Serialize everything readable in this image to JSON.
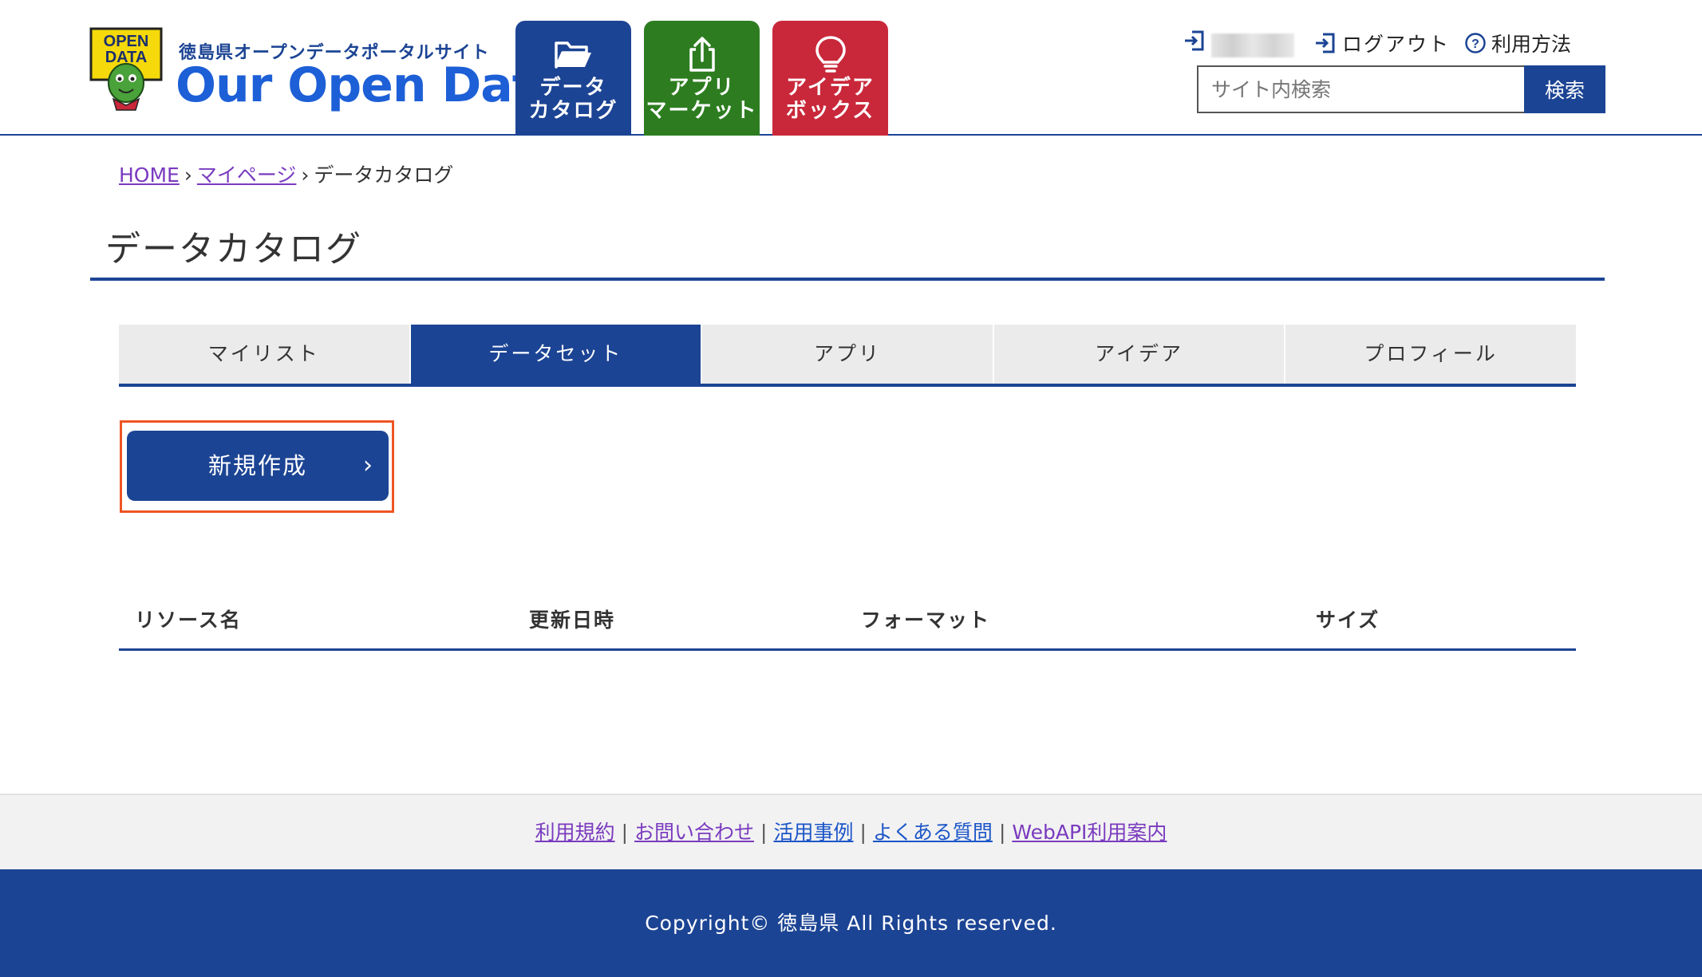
{
  "header": {
    "logo_badge_line1": "OPEN",
    "logo_badge_line2": "DATA",
    "site_subtitle": "徳島県オープンデータポータルサイト",
    "site_title": "Our Open Data",
    "nav": [
      {
        "label": "データ\nカタログ",
        "icon": "folder-open-icon",
        "color": "#1c4494"
      },
      {
        "label": "アプリ\nマーケット",
        "icon": "share-upload-icon",
        "color": "#2d7d20"
      },
      {
        "label": "アイデア\nボックス",
        "icon": "lightbulb-icon",
        "color": "#c9283a"
      }
    ],
    "logout_label": "ログアウト",
    "help_label": "利用方法",
    "search_placeholder": "サイト内検索",
    "search_button": "検索"
  },
  "breadcrumb": {
    "home": "HOME",
    "sep": "›",
    "mypage": "マイページ",
    "current": "データカタログ"
  },
  "page_title": "データカタログ",
  "tabs": [
    "マイリスト",
    "データセット",
    "アプリ",
    "アイデア",
    "プロフィール"
  ],
  "active_tab": 1,
  "new_button": "新規作成",
  "table_headers": [
    "リソース名",
    "更新日時",
    "フォーマット",
    "サイズ"
  ],
  "footer": {
    "links": [
      "利用規約",
      "お問い合わせ",
      "活用事例",
      "よくある質問",
      "WebAPI利用案内"
    ],
    "separator": "|",
    "copyright": "Copyright© 徳島県 All Rights reserved."
  },
  "colors": {
    "primary": "#1c4494",
    "green": "#2d7d20",
    "red": "#c9283a",
    "highlight": "#ee5524",
    "visited_link": "#7a3bbf"
  }
}
